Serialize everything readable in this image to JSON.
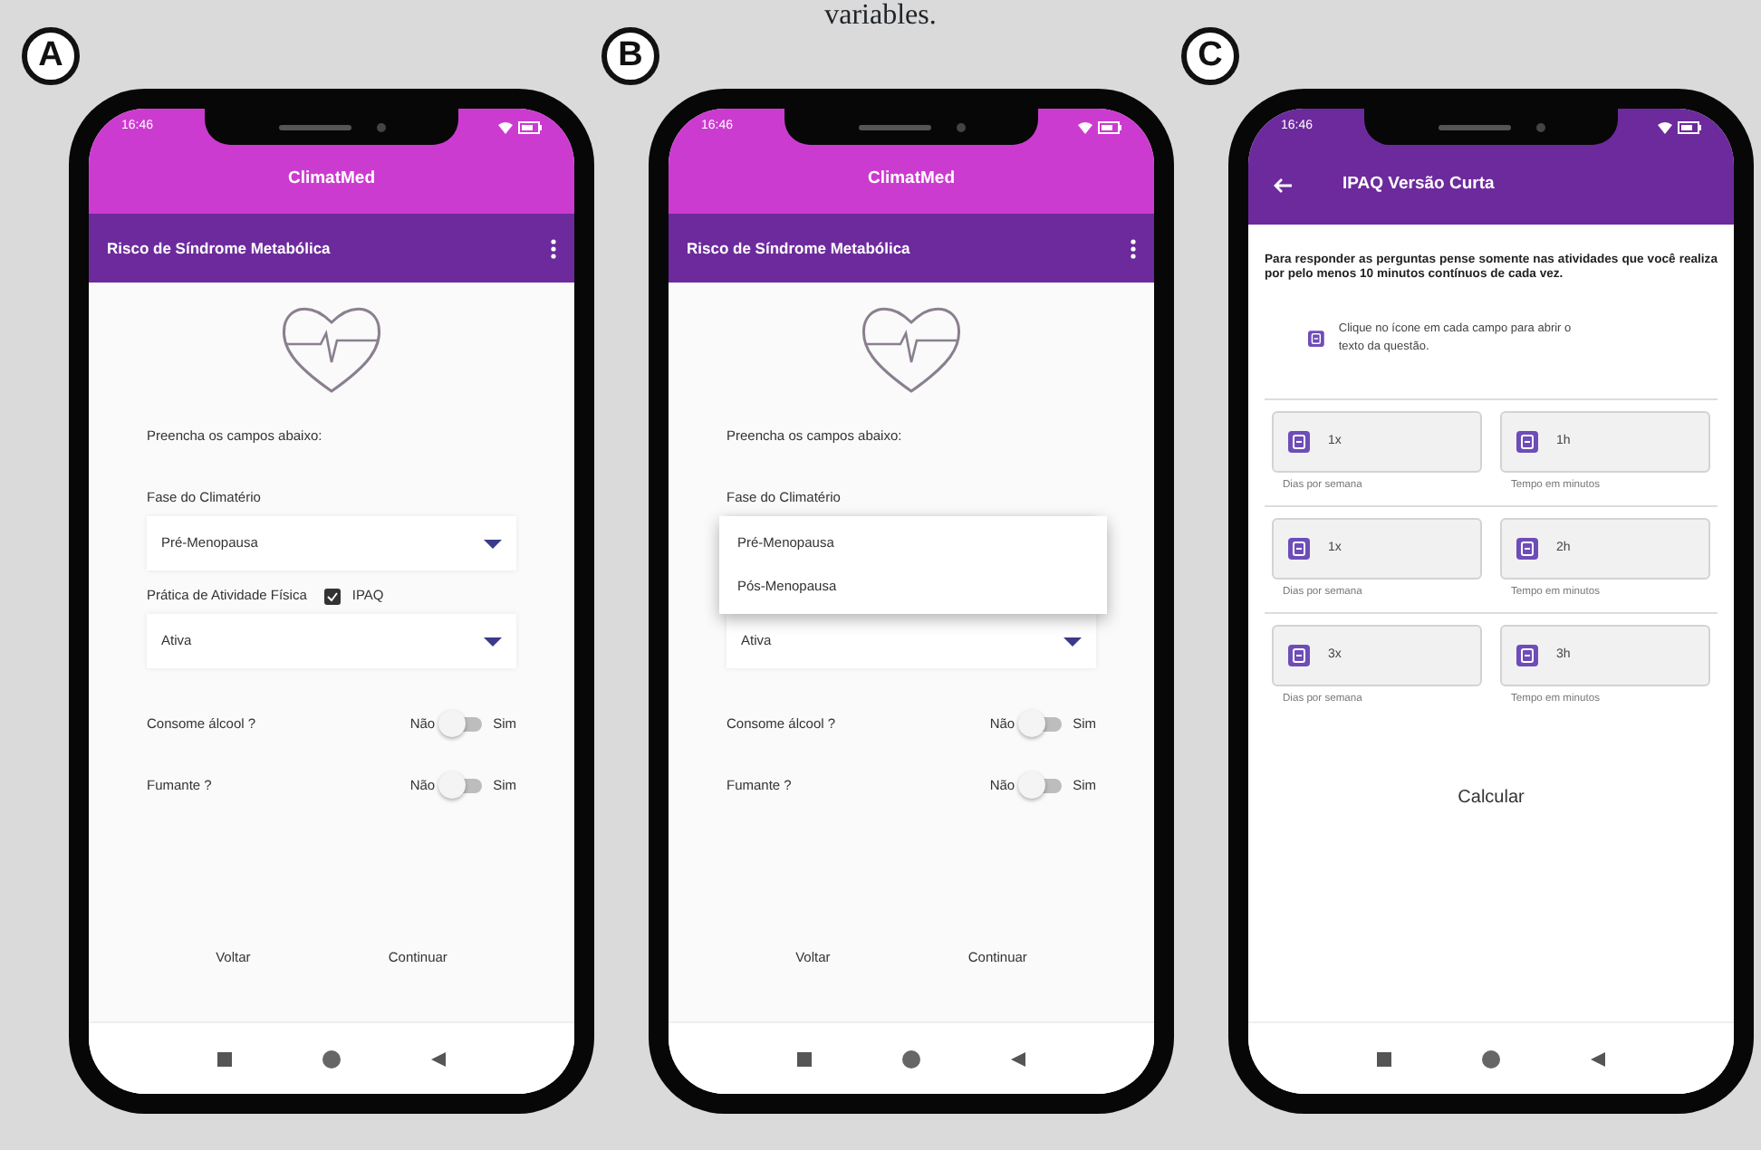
{
  "caption": "variables.",
  "panels": [
    {
      "label": "A",
      "kind": "form",
      "status_time": "16:46",
      "app_title": "ClimatMed",
      "screen_title": "Risco de Síndrome Metabólica",
      "intro": "Preencha os campos abaixo:",
      "fields": [
        {
          "kind": "select",
          "label": "Fase do Climatério",
          "value": "Pré-Menopausa",
          "expanded": false
        },
        {
          "kind": "select",
          "label": "Prática de Atividade Física",
          "link": "IPAQ",
          "value": "Ativa",
          "expanded": false
        },
        {
          "kind": "switch",
          "label": "Consome álcool ?",
          "off_label": "Não",
          "on_label": "Sim",
          "on": false
        },
        {
          "kind": "switch",
          "label": "Fumante ?",
          "off_label": "Não",
          "on_label": "Sim",
          "on": false
        }
      ],
      "buttons": [
        "Voltar",
        "Continuar"
      ]
    },
    {
      "label": "B",
      "kind": "form",
      "status_time": "16:46",
      "app_title": "ClimatMed",
      "screen_title": "Risco de Síndrome Metabólica",
      "intro": "Preencha os campos abaixo:",
      "fields": [
        {
          "kind": "select",
          "label": "Fase do Climatério",
          "expanded": true,
          "options": [
            "Pré-Menopausa",
            "Pós-Menopausa"
          ]
        },
        {
          "kind": "select",
          "value": "Ativa",
          "expanded": false
        },
        {
          "kind": "switch",
          "label": "Consome álcool ?",
          "off_label": "Não",
          "on_label": "Sim",
          "on": false
        },
        {
          "kind": "switch",
          "label": "Fumante ?",
          "off_label": "Não",
          "on_label": "Sim",
          "on": false
        }
      ],
      "buttons": [
        "Voltar",
        "Continuar"
      ]
    },
    {
      "label": "C",
      "kind": "ipaq",
      "status_time": "16:46",
      "screen_title": "IPAQ Versão Curta",
      "intro": "Para responder as perguntas pense somente nas atividades que você realiza por pelo menos 10 minutos contínuos de cada vez.",
      "hint": "Clique no ícone em cada campo para abrir o texto da questão.",
      "groups": [
        [
          {
            "value": "1x",
            "helper": "Dias por semana"
          },
          {
            "value": "1h",
            "helper": "Tempo em minutos"
          }
        ],
        [
          {
            "value": "1x",
            "helper": "Dias por semana"
          },
          {
            "value": "2h",
            "helper": "Tempo em minutos"
          }
        ],
        [
          {
            "value": "3x",
            "helper": "Dias por semana"
          },
          {
            "value": "3h",
            "helper": "Tempo em minutos"
          }
        ]
      ],
      "button": "Calcular"
    }
  ]
}
